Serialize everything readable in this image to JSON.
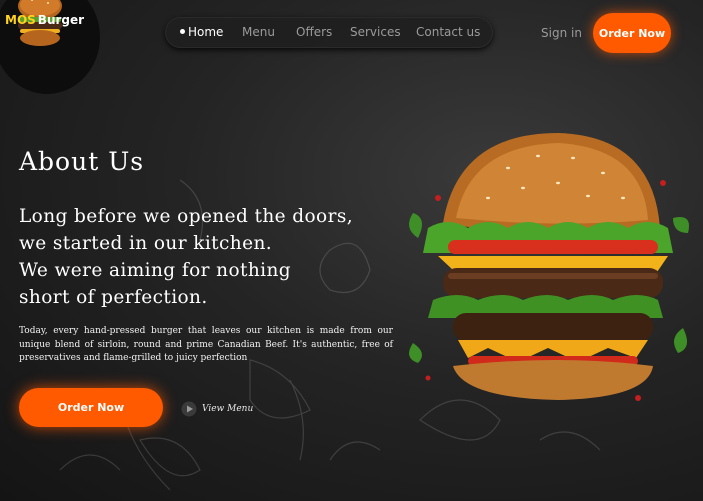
{
  "logo": {
    "text_primary": "MOS",
    "text_secondary": "Burger"
  },
  "nav": {
    "items": [
      {
        "label": "Home",
        "active": true
      },
      {
        "label": "Menu",
        "active": false
      },
      {
        "label": "Offers",
        "active": false
      },
      {
        "label": "Services",
        "active": false
      },
      {
        "label": "Contact us",
        "active": false
      }
    ]
  },
  "header": {
    "sign_in": "Sign in",
    "order_button": "Order Now"
  },
  "hero": {
    "heading": "About Us",
    "tagline_lines": [
      "Long before we opened the doors,",
      "we started in our kitchen.",
      "We were aiming for nothing",
      "short of perfection."
    ],
    "description": "Today, every hand-pressed burger that leaves our kitchen is made from our unique blend of sirloin, round and prime Canadian Beef. It's authentic, free of preservatives and flame-grilled to juicy perfection",
    "order_button": "Order Now",
    "view_menu": "View Menu"
  },
  "colors": {
    "accent": "#ff5a00",
    "logo_accent": "#ffd21f",
    "background": "#242424"
  },
  "icons": {
    "logo": "burger-logo-icon",
    "play": "play-icon",
    "hero_image": "burger-image"
  }
}
